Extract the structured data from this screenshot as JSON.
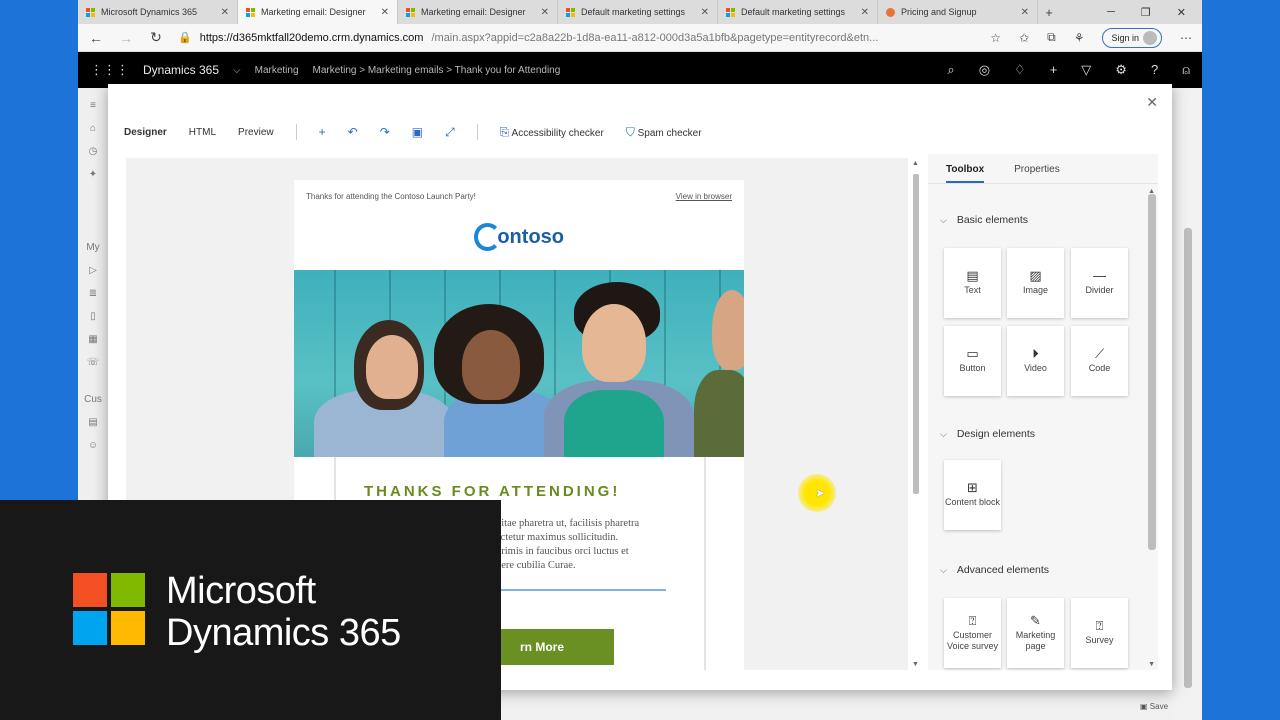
{
  "browser": {
    "tabs": [
      {
        "title": "Microsoft Dynamics 365",
        "favicon": "ms-logo-icon",
        "active": false
      },
      {
        "title": "Marketing email: Designer",
        "favicon": "ms-logo-icon",
        "active": true
      },
      {
        "title": "Marketing email: Designer",
        "favicon": "ms-logo-icon",
        "active": false
      },
      {
        "title": "Default marketing settings",
        "favicon": "ms-logo-icon",
        "active": false
      },
      {
        "title": "Default marketing settings",
        "favicon": "ms-logo-icon",
        "active": false
      },
      {
        "title": "Pricing and Signup",
        "favicon": "orange-circle-icon",
        "active": false
      }
    ],
    "url_host": "https://d365mktfall20demo.crm.dynamics.com",
    "url_rest": "/main.aspx?appid=c2a8a22b-1d8a-ea11-a812-000d3a5a1bfb&pagetype=entityrecord&etn...",
    "signin_label": "Sign in"
  },
  "d365": {
    "app_name": "Dynamics 365",
    "area": "Marketing",
    "crumbs": [
      "Marketing",
      ">",
      "Marketing emails",
      ">",
      "Thank you for Attending"
    ]
  },
  "leftnav": {
    "section_my": "My",
    "section_cus": "Cus"
  },
  "designer": {
    "toolbar": {
      "designer": "Designer",
      "html": "HTML",
      "preview": "Preview",
      "accessibility": "Accessibility checker",
      "spam": "Spam checker"
    },
    "email": {
      "preheader": "Thanks for attending the Contoso Launch Party!",
      "view_in_browser": "View in browser",
      "logo_text": "ontoso",
      "heading": "THANKS FOR ATTENDING!",
      "body_lines": [
        "vitae pharetra ut, facilisis pharetra",
        "ectetur maximus sollicitudin.",
        "primis in faucibus orci luctus et",
        "uere cubilia Curae."
      ],
      "button_label": "rn More"
    },
    "panel": {
      "tabs": [
        "Toolbox",
        "Properties"
      ],
      "sections": {
        "basic": "Basic elements",
        "design": "Design elements",
        "advanced": "Advanced elements"
      },
      "basic_tiles": [
        "Text",
        "Image",
        "Divider",
        "Button",
        "Video",
        "Code"
      ],
      "design_tiles": [
        "Content block"
      ],
      "advanced_tiles": [
        "Customer Voice survey",
        "Marketing page",
        "Survey"
      ]
    }
  },
  "overlay": {
    "line1": "Microsoft",
    "line2": "Dynamics 365"
  },
  "status": {
    "save": "Save"
  },
  "colors": {
    "accent": "#2b66c9",
    "heading_green": "#6a8a1e",
    "button_green": "#6a8f23",
    "d365_bar": "#000000"
  }
}
